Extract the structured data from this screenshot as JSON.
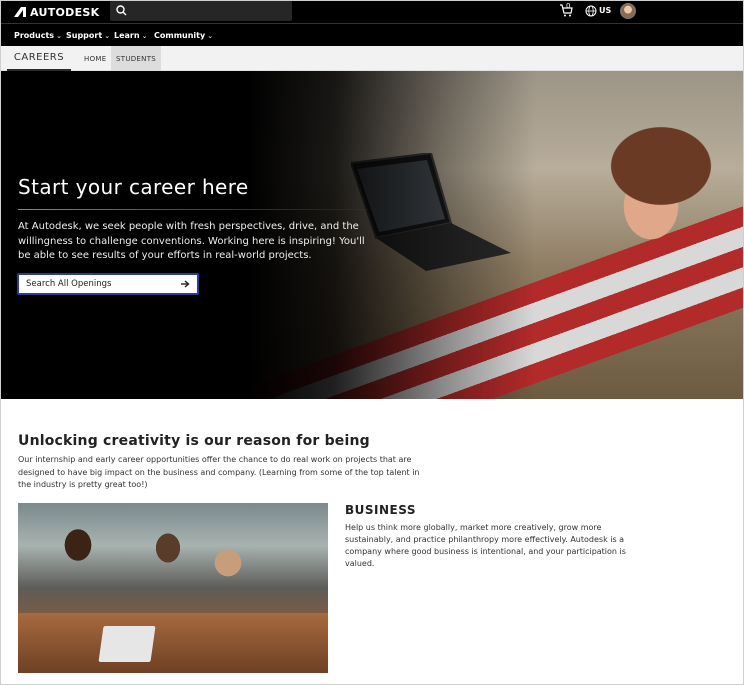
{
  "header": {
    "brand": "AUTODESK",
    "cart_count": "0",
    "language": "US",
    "icons": [
      "autodesk-logo-icon",
      "search-icon",
      "cart-icon",
      "globe-icon",
      "avatar"
    ]
  },
  "nav": {
    "items": [
      {
        "label": "Products"
      },
      {
        "label": "Support"
      },
      {
        "label": "Learn"
      },
      {
        "label": "Community"
      }
    ]
  },
  "subnav": {
    "section": "CAREERS",
    "tabs": [
      {
        "label": "HOME",
        "active": false
      },
      {
        "label": "STUDENTS",
        "active": true
      }
    ]
  },
  "hero": {
    "title": "Start your career here",
    "text": "At Autodesk, we seek people with fresh perspectives, drive, and the willingness to challenge conventions. Working here is inspiring! You'll be able to see results of your efforts in real-world projects.",
    "button_label": "Search All Openings",
    "button_icon": "arrow-right-icon"
  },
  "content": {
    "title": "Unlocking creativity is our reason for being",
    "text": "Our internship and early career opportunities offer the chance to do real work on projects that are designed to have big impact on the business and company. (Learning from some of the top talent in the industry is pretty great too!)",
    "business": {
      "title": "BUSINESS",
      "text": "Help us think more globally, market more creatively, grow more sustainably, and practice philanthropy more effectively. Autodesk is a company where good business is intentional, and your participation is valued."
    }
  },
  "colors": {
    "header_bg": "#000000",
    "subnav_bg": "#f2f2f2",
    "button_border": "#2c3e8f"
  }
}
